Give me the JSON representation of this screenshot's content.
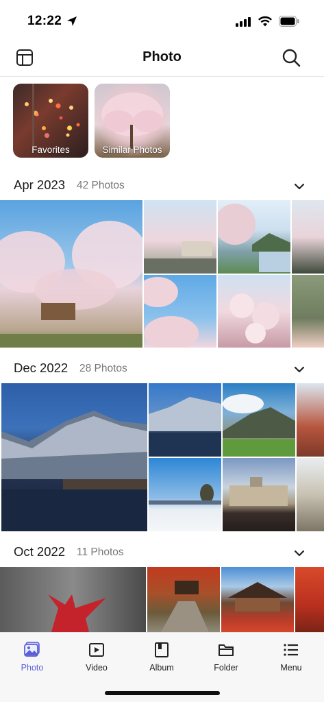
{
  "status": {
    "time": "12:22"
  },
  "header": {
    "title": "Photo"
  },
  "albums": [
    {
      "label": "Favorites"
    },
    {
      "label": "Similar Photos"
    }
  ],
  "sections": [
    {
      "date": "Apr 2023",
      "count": "42 Photos"
    },
    {
      "date": "Dec 2022",
      "count": "28 Photos"
    },
    {
      "date": "Oct 2022",
      "count": "11 Photos"
    }
  ],
  "tabs": [
    {
      "label": "Photo",
      "icon": "photo-icon",
      "active": true
    },
    {
      "label": "Video",
      "icon": "video-icon",
      "active": false
    },
    {
      "label": "Album",
      "icon": "album-icon",
      "active": false
    },
    {
      "label": "Folder",
      "icon": "folder-icon",
      "active": false
    },
    {
      "label": "Menu",
      "icon": "menu-icon",
      "active": false
    }
  ],
  "colors": {
    "accent": "#5b5fd8"
  }
}
